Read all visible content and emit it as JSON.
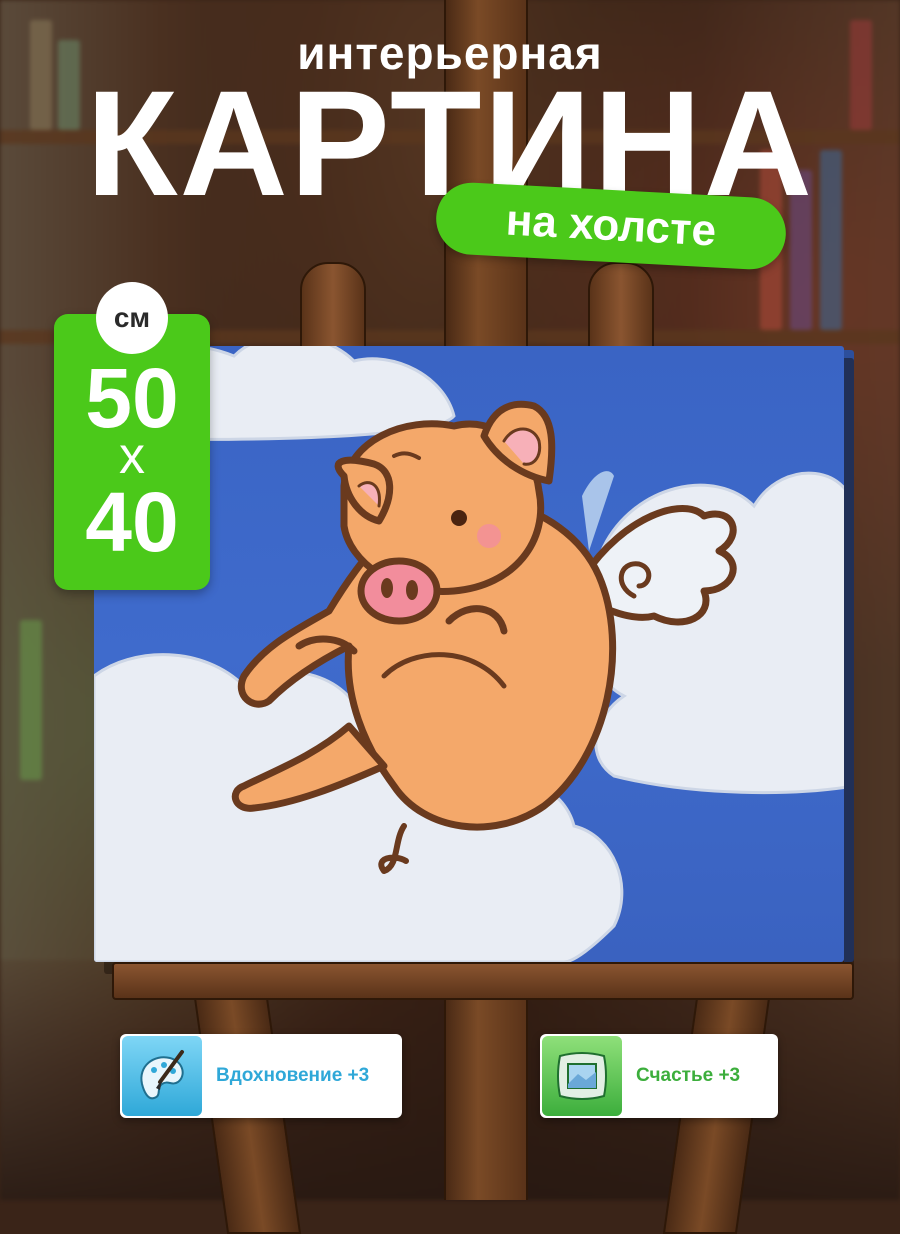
{
  "headline": {
    "subtitle": "интерьерная",
    "title": "КАРТИНА",
    "pill": "на холсте"
  },
  "size": {
    "unit": "см",
    "width": "50",
    "separator": "х",
    "height": "40"
  },
  "buffs": [
    {
      "label": "Вдохновение +3",
      "icon": "palette-brush-icon",
      "color": "#2fa8d8"
    },
    {
      "label": "Счастье +3",
      "icon": "pillow-picture-icon",
      "color": "#3cae3c"
    }
  ],
  "colors": {
    "accent_green": "#4bc91a",
    "sky_blue": "#3a64c4",
    "pig_orange": "#f4a86a"
  }
}
